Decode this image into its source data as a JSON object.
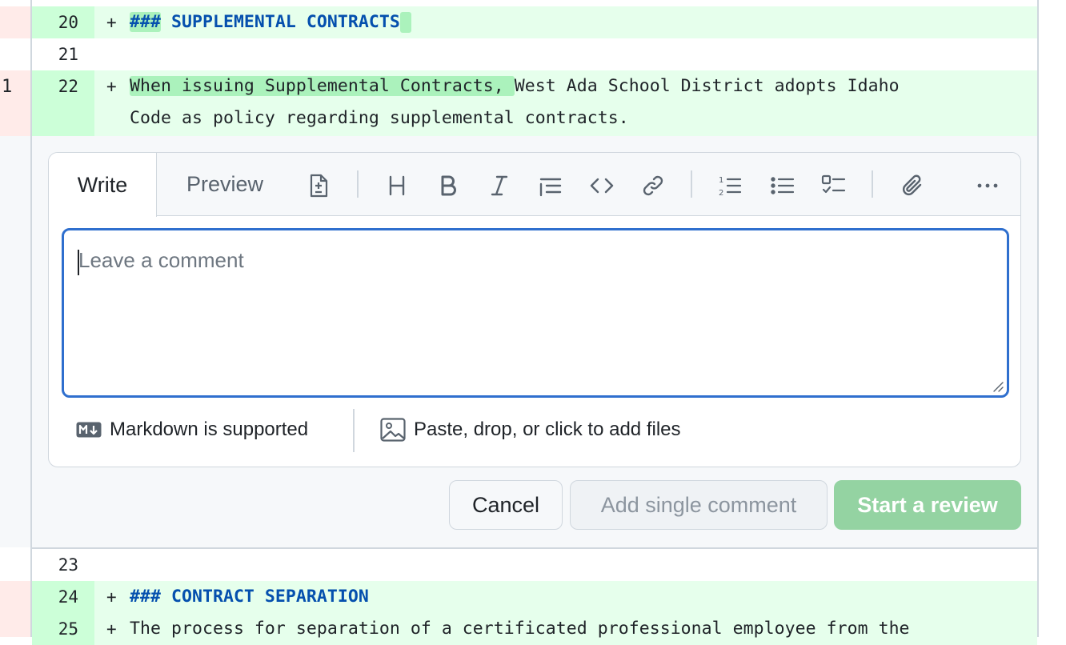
{
  "left_strip": {
    "line_number": "1"
  },
  "diff": {
    "rows": [
      {
        "num": "20",
        "sign": "+",
        "text_hl": "###",
        "text": " SUPPLEMENTAL CONTRACTS"
      },
      {
        "num": "21",
        "sign": "",
        "text": ""
      },
      {
        "num": "22",
        "sign": "+",
        "text_hl": "When issuing Supplemental Contracts, ",
        "text": "West Ada School District adopts Idaho",
        "text_cont": "Code as policy regarding supplemental contracts."
      },
      {
        "num": "23",
        "sign": "",
        "text": ""
      },
      {
        "num": "24",
        "sign": "+",
        "text": "### CONTRACT SEPARATION"
      },
      {
        "num": "25",
        "sign": "+",
        "text": "The process for separation of a certificated professional employee from the"
      }
    ]
  },
  "comment_form": {
    "tabs": {
      "write": "Write",
      "preview": "Preview"
    },
    "textarea": {
      "placeholder": "Leave a comment",
      "value": ""
    },
    "footer": {
      "markdown_label": "Markdown is supported",
      "files_label": "Paste, drop, or click to add files"
    },
    "toolbar_icons": [
      "diff-icon",
      "heading-icon",
      "bold-icon",
      "italic-icon",
      "quote-icon",
      "code-icon",
      "link-icon",
      "ordered-list-icon",
      "unordered-list-icon",
      "task-list-icon",
      "attach-icon",
      "more-icon"
    ]
  },
  "buttons": {
    "cancel": "Cancel",
    "add_single": "Add single comment",
    "start_review": "Start a review"
  },
  "colors": {
    "added_bg": "#e6ffec",
    "added_num_bg": "#ccffd8",
    "highlight": "#abf2bc",
    "heading_blue": "#0550ae",
    "focus_blue": "#2f6fce",
    "review_button": "#94d3a2"
  }
}
